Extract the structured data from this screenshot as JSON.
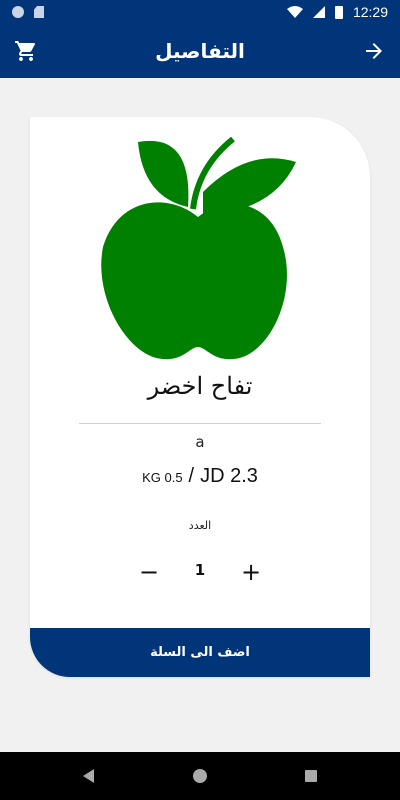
{
  "status_bar": {
    "time": "12:29"
  },
  "app_bar": {
    "title": "التفاصيل"
  },
  "product": {
    "name": "تفاح اخضر",
    "description": "a",
    "weight": "KG 0.5",
    "separator": "/",
    "price": "JD 2.3",
    "image_icon": "green-apple"
  },
  "quantity": {
    "label": "العدد",
    "minus": "−",
    "value": "1",
    "plus": "+"
  },
  "actions": {
    "add_to_cart_label": "اضف الى السلة"
  },
  "colors": {
    "primary": "#00357a",
    "apple_green": "#008000",
    "background": "#f1f1f1"
  }
}
